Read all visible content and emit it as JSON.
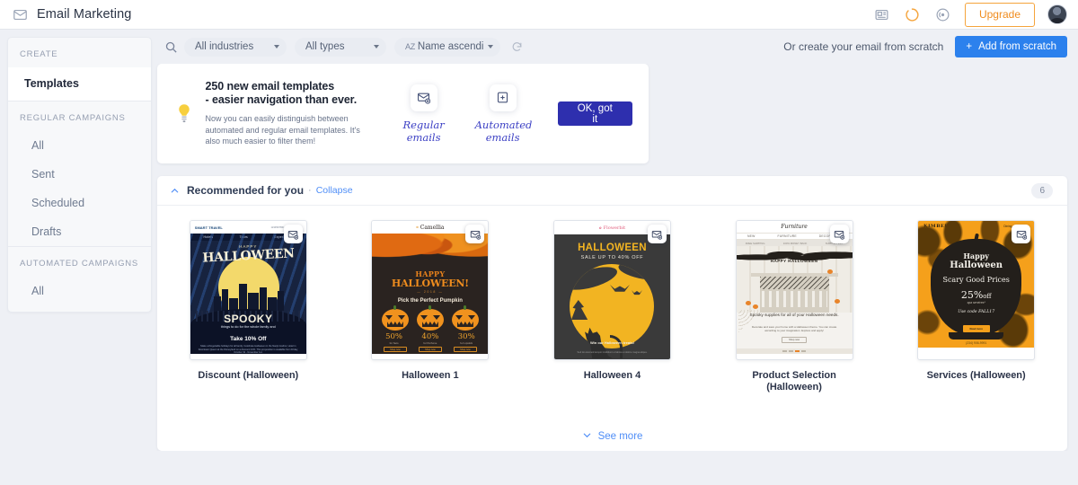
{
  "topbar": {
    "app_icon": "envelope-icon",
    "title": "Email Marketing",
    "icons": [
      "news-icon",
      "loading-spinner-icon",
      "broadcast-icon"
    ],
    "upgrade_label": "Upgrade",
    "avatar": "user-avatar"
  },
  "sidebar": {
    "groups": [
      {
        "label": "CREATE",
        "items": [
          {
            "label": "Templates",
            "active": true
          }
        ]
      },
      {
        "label": "REGULAR CAMPAIGNS",
        "items": [
          {
            "label": "All",
            "active": false
          },
          {
            "label": "Sent",
            "active": false
          },
          {
            "label": "Scheduled",
            "active": false
          },
          {
            "label": "Drafts",
            "active": false
          }
        ]
      },
      {
        "label": "AUTOMATED CAMPAIGNS",
        "items": [
          {
            "label": "All",
            "active": false
          }
        ]
      }
    ]
  },
  "toolbar": {
    "search_icon": "search-icon",
    "filters": [
      {
        "label": "All industries"
      },
      {
        "label": "All types"
      },
      {
        "label": "Name ascending",
        "prefix": "AZ"
      }
    ],
    "reset_icon": "reset-icon",
    "scratch_text": "Or create your email from scratch",
    "add_button": "Add from scratch",
    "add_button_plus": "+"
  },
  "banner": {
    "icon": "lightbulb-icon",
    "heading_line1": "250 new email templates",
    "heading_line2": "- easier navigation than ever.",
    "paragraph": "Now you can easily distinguish between automated and regular email templates. It's also much easier to filter them!",
    "icon_columns": [
      {
        "icon": "envelope-plus-icon",
        "label_line1": "Regular",
        "label_line2": "emails"
      },
      {
        "icon": "document-plus-icon",
        "label_line1": "Automated",
        "label_line2": "emails"
      }
    ],
    "ok_button": "OK, got it"
  },
  "recommended": {
    "chevron": "chevron-up-icon",
    "title": "Recommended for you",
    "separator": "·",
    "collapse_label": "Collapse",
    "count": "6",
    "see_more_label": "See more",
    "see_more_chevron": "chevron-down-icon",
    "badge_icon": "envelope-plus-icon",
    "cards": [
      {
        "name": "Discount (Halloween)",
        "brand": "SMART TRAVEL",
        "nav": [
          "Hotels",
          "Tours",
          "Experiences"
        ],
        "happy": "HAPPY",
        "halloween": "HALLOWEEN",
        "spooky": "SPOOKY",
        "sub": "things to do for the whole family and",
        "take": "Take 10% Off",
        "fine": "Make unforgettable holidays for all family. Celebrate Halloween in the Nanjin Harbor, Hotel in Downtown Queen at the Disneyland on a discount 10%. This proposition is available from Friday, October 19 - November 1st.",
        "header_small": "1234567890     www.@mail.com"
      },
      {
        "name": "Halloween 1",
        "brand": "Camellia",
        "nav": [
          "Makeup",
          "Fragrance",
          "Solutions"
        ],
        "happy": "HAPPY",
        "halloween": "HALLOWEEN!",
        "year": "— 2018 —",
        "pick": "Pick the Perfect Pumpkin",
        "offers": [
          {
            "pct": "50%",
            "for": "for Sets",
            "btn": "Shop now"
          },
          {
            "pct": "40%",
            "for": "for Perfume",
            "btn": "Shop now"
          },
          {
            "pct": "30%",
            "for": "for Lipstick",
            "btn": "Shop now"
          }
        ]
      },
      {
        "name": "Halloween 4",
        "brand": "Flowerbit",
        "title": "HALLOWEEN",
        "subtitle": "SALE UP TO 40% OFF",
        "win": "Win our Halloween treats!",
        "fine": "Sed do eiusmod tempor incididunt ut labore et dolore magna aliqua."
      },
      {
        "name": "Product Selection (Halloween)",
        "brand": "Furniture",
        "nav": [
          "NEW",
          "FURNITURE",
          "DECORATING"
        ],
        "strip": [
          "FREE SHIPPING",
          "100% MONEY BACK",
          "SUPPORT 24/7"
        ],
        "banner_text": "HAPPY HALLOWEEN",
        "txt1": "Spooky supplies for all of your Halloween needs.",
        "txt2": "Decorate and save your home with a Halloween theme. You can create according to your imagination. Explore and apply!",
        "cta": "Shop now"
      },
      {
        "name": "Services (Halloween)",
        "brand": "KIMBERLYN",
        "nav": [
          "Rooms",
          "Dining",
          "Events"
        ],
        "happy": "Happy",
        "halloween": "Halloween",
        "scary": "Scary Good Prices",
        "pct": "25%",
        "pct_suffix": "off",
        "pct_sub": "spa services*",
        "code": "Use code FALL17",
        "btn": "Read more",
        "phone": "(234) 906-9991"
      }
    ]
  },
  "colors": {
    "accent_blue": "#2c81ed",
    "indigo_button": "#2e2fae",
    "upgrade_orange": "#f08c1e",
    "page_background": "#eef0f5",
    "link_blue": "#4f8ef7"
  }
}
